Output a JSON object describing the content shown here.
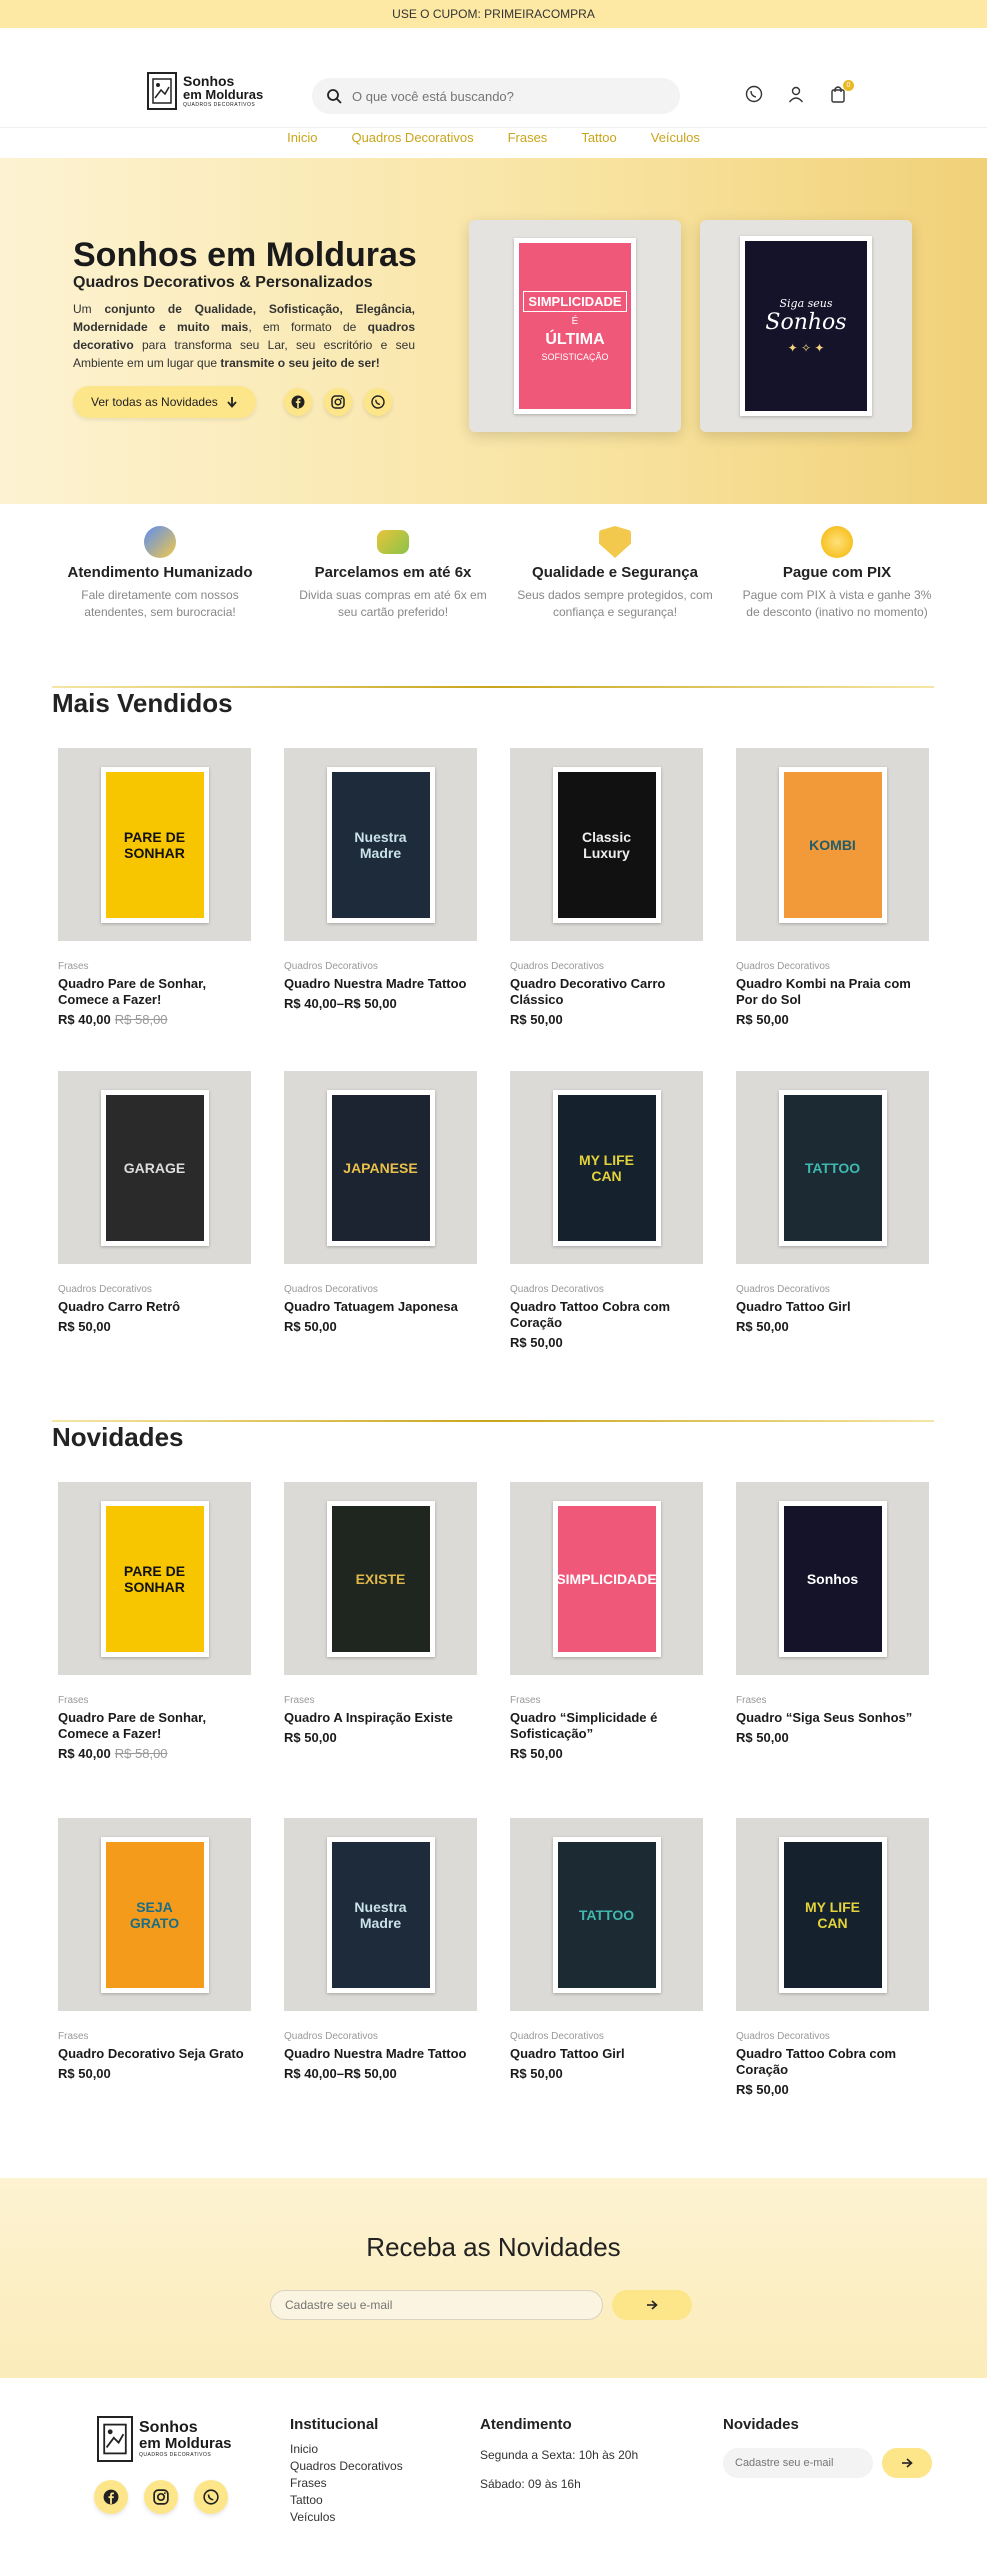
{
  "topbar": {
    "text": "USE O CUPOM: PRIMEIRACOMPRA"
  },
  "logo": {
    "line1": "Sonhos",
    "line2": "em Molduras",
    "line3": "QUADROS DECORATIVOS"
  },
  "search": {
    "placeholder": "O que você está buscando?"
  },
  "header_icons": {
    "cart_count": "0"
  },
  "nav": [
    "Inicio",
    "Quadros Decorativos",
    "Frases",
    "Tattoo",
    "Veículos"
  ],
  "hero": {
    "title": "Sonhos em Molduras",
    "subtitle": "Quadros Decorativos & Personalizados",
    "desc_1": "Um ",
    "desc_2": "conjunto de Qualidade, Sofisticação, Elegância, Modernidade e muito mais",
    "desc_3": ", em formato de ",
    "desc_4": "quadros decorativo",
    "desc_5": " para transforma seu Lar, seu escritório e seu Ambiente em um lugar que ",
    "desc_6": "transmite o seu jeito de ser!",
    "cta": "Ver todas as Novidades",
    "poster1": [
      "SIMPLICIDADE",
      "É",
      "ÚLTIMA",
      "SOFISTICAÇÃO"
    ],
    "poster2": [
      "Siga seus",
      "Sonhos"
    ]
  },
  "features": [
    {
      "title": "Atendimento Humanizado",
      "desc": "Fale diretamente com nossos atendentes, sem burocracia!",
      "color": "#5b8def"
    },
    {
      "title": "Parcelamos em até 6x",
      "desc": "Divida suas compras em até 6x em seu cartão preferido!",
      "color": "#e8c43a"
    },
    {
      "title": "Qualidade e Segurança",
      "desc": "Seus dados sempre protegidos, com confiança e segurança!",
      "color": "#f2c94c"
    },
    {
      "title": "Pague com PIX",
      "desc": "Pague com PIX à vista e ganhe 3% de desconto (inativo no momento)",
      "color": "#f4b400"
    }
  ],
  "best_sellers": {
    "title": "Mais Vendidos",
    "products": [
      {
        "cat": "Frases",
        "name": "Quadro Pare de Sonhar, Comece a Fazer!",
        "price": "R$ 40,00",
        "old": "R$ 58,00",
        "bg": "#f7c600",
        "fg": "#111",
        "art": "PARE DE SONHAR"
      },
      {
        "cat": "Quadros Decorativos",
        "name": "Quadro Nuestra Madre Tattoo",
        "price": "R$ 40,00–R$ 50,00",
        "old": "",
        "bg": "#1d2b3a",
        "fg": "#c9e2e8",
        "art": "Nuestra Madre"
      },
      {
        "cat": "Quadros Decorativos",
        "name": "Quadro Decorativo Carro Clássico",
        "price": "R$ 50,00",
        "old": "",
        "bg": "#111",
        "fg": "#eee",
        "art": "Classic Luxury"
      },
      {
        "cat": "Quadros Decorativos",
        "name": "Quadro Kombi na Praia com Por do Sol",
        "price": "R$ 50,00",
        "old": "",
        "bg": "#f29a3a",
        "fg": "#1f5d6b",
        "art": "KOMBI"
      },
      {
        "cat": "Quadros Decorativos",
        "name": "Quadro Carro Retrô",
        "price": "R$ 50,00",
        "old": "",
        "bg": "#2a2a2a",
        "fg": "#ddd",
        "art": "GARAGE"
      },
      {
        "cat": "Quadros Decorativos",
        "name": "Quadro Tatuagem Japonesa",
        "price": "R$ 50,00",
        "old": "",
        "bg": "#1b2430",
        "fg": "#e8c04a",
        "art": "JAPANESE"
      },
      {
        "cat": "Quadros Decorativos",
        "name": "Quadro Tattoo Cobra com Coração",
        "price": "R$ 50,00",
        "old": "",
        "bg": "#15222e",
        "fg": "#e3d23a",
        "art": "MY LIFE CAN"
      },
      {
        "cat": "Quadros Decorativos",
        "name": "Quadro Tattoo Girl",
        "price": "R$ 50,00",
        "old": "",
        "bg": "#1b2a33",
        "fg": "#3fb8b0",
        "art": "TATTOO"
      }
    ]
  },
  "news": {
    "title": "Novidades",
    "products": [
      {
        "cat": "Frases",
        "name": "Quadro Pare de Sonhar, Comece a Fazer!",
        "price": "R$ 40,00",
        "old": "R$ 58,00",
        "bg": "#f7c600",
        "fg": "#111",
        "art": "PARE DE SONHAR"
      },
      {
        "cat": "Frases",
        "name": "Quadro A Inspiração Existe",
        "price": "R$ 50,00",
        "old": "",
        "bg": "#1f2620",
        "fg": "#e0b84a",
        "art": "EXISTE"
      },
      {
        "cat": "Frases",
        "name": "Quadro “Simplicidade é Sofisticação”",
        "price": "R$ 50,00",
        "old": "",
        "bg": "#f0587a",
        "fg": "#fff",
        "art": "SIMPLICIDADE"
      },
      {
        "cat": "Frases",
        "name": "Quadro “Siga Seus Sonhos”",
        "price": "R$ 50,00",
        "old": "",
        "bg": "#14132a",
        "fg": "#fff",
        "art": "Sonhos"
      },
      {
        "cat": "Frases",
        "name": "Quadro Decorativo Seja Grato",
        "price": "R$ 50,00",
        "old": "",
        "bg": "#f59b1c",
        "fg": "#1a6d86",
        "art": "SEJA GRATO"
      },
      {
        "cat": "Quadros Decorativos",
        "name": "Quadro Nuestra Madre Tattoo",
        "price": "R$ 40,00–R$ 50,00",
        "old": "",
        "bg": "#1d2b3a",
        "fg": "#c9e2e8",
        "art": "Nuestra Madre"
      },
      {
        "cat": "Quadros Decorativos",
        "name": "Quadro Tattoo Girl",
        "price": "R$ 50,00",
        "old": "",
        "bg": "#1b2a33",
        "fg": "#3fb8b0",
        "art": "TATTOO"
      },
      {
        "cat": "Quadros Decorativos",
        "name": "Quadro Tattoo Cobra com Coração",
        "price": "R$ 50,00",
        "old": "",
        "bg": "#15222e",
        "fg": "#e3d23a",
        "art": "MY LIFE CAN"
      }
    ]
  },
  "newsletter": {
    "title": "Receba as Novidades",
    "placeholder": "Cadastre seu e-mail"
  },
  "footer": {
    "institucional_title": "Institucional",
    "institucional_links": [
      "Inicio",
      "Quadros Decorativos",
      "Frases",
      "Tattoo",
      "Veículos"
    ],
    "atendimento_title": "Atendimento",
    "atendimento_lines": [
      "Segunda a Sexta: 10h às 20h",
      "Sábado: 09 às 16h"
    ],
    "novidades_title": "Novidades",
    "novidades_placeholder": "Cadastre seu e-mail"
  },
  "colors": {
    "accent": "#fde58a",
    "nav_link": "#c9a51a"
  },
  "icons": [
    "search-icon",
    "whatsapp-icon",
    "user-icon",
    "cart-icon",
    "arrow-down-icon",
    "facebook-icon",
    "instagram-icon",
    "arrow-right-icon"
  ]
}
